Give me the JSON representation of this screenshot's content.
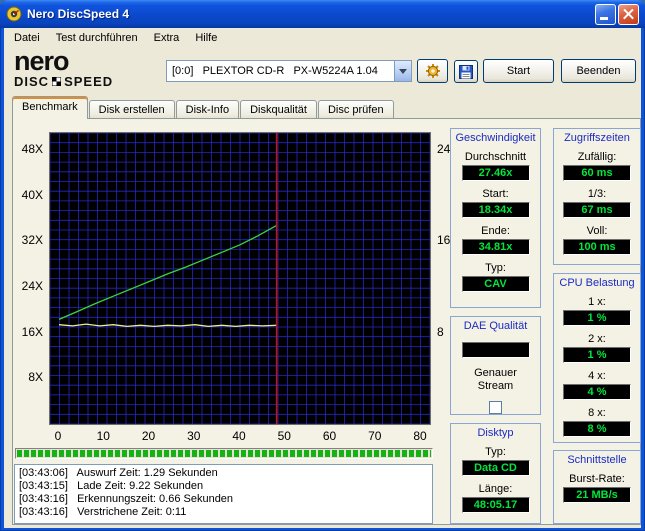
{
  "window": {
    "title": "Nero DiscSpeed 4"
  },
  "menu": {
    "items": [
      "Datei",
      "Test durchführen",
      "Extra",
      "Hilfe"
    ]
  },
  "toolbar": {
    "logo_brand": "nero",
    "logo_product_left": "DISC",
    "logo_product_right": "SPEED",
    "drive_selector": "[0:0]   PLEXTOR CD-R   PX-W5224A 1.04",
    "start_label": "Start",
    "quit_label": "Beenden"
  },
  "tabs": {
    "items": [
      "Benchmark",
      "Disk erstellen",
      "Disk-Info",
      "Diskqualität",
      "Disc prüfen"
    ],
    "active": "Benchmark"
  },
  "chart_data": {
    "type": "line",
    "xlim": [
      0,
      80
    ],
    "ylim_left": [
      0,
      51
    ],
    "ylim_right": [
      0,
      25.5
    ],
    "x_ticks": [
      0,
      10,
      20,
      30,
      40,
      50,
      60,
      70,
      80
    ],
    "y_tick_labels_left": [
      "48X",
      "40X",
      "32X",
      "24X",
      "16X",
      "8X"
    ],
    "y_tick_values_left": [
      48,
      40,
      32,
      24,
      16,
      8
    ],
    "y_tick_labels_right": [
      "24",
      "16",
      "8"
    ],
    "y_tick_values_right": [
      48,
      32,
      16
    ],
    "grid": true,
    "legend_position": "none",
    "series": [
      {
        "name": "read-speed-x",
        "color": "#3cd43c",
        "axis": "left",
        "points": [
          [
            0,
            18.34
          ],
          [
            4,
            19.7
          ],
          [
            8,
            21.1
          ],
          [
            12,
            22.4
          ],
          [
            16,
            23.7
          ],
          [
            20,
            25.0
          ],
          [
            24,
            26.3
          ],
          [
            28,
            27.5
          ],
          [
            32,
            28.8
          ],
          [
            36,
            30.1
          ],
          [
            40,
            31.4
          ],
          [
            44,
            33.0
          ],
          [
            48.09,
            34.81
          ]
        ]
      },
      {
        "name": "rotation-speed",
        "color": "#eded8a",
        "axis": "left",
        "points": [
          [
            0,
            17.4
          ],
          [
            3,
            17.2
          ],
          [
            6,
            17.5
          ],
          [
            9,
            17.2
          ],
          [
            12,
            17.4
          ],
          [
            15,
            17.1
          ],
          [
            18,
            17.3
          ],
          [
            21,
            17.1
          ],
          [
            24,
            17.3
          ],
          [
            27,
            17.2
          ],
          [
            30,
            17.4
          ],
          [
            33,
            17.1
          ],
          [
            36,
            17.3
          ],
          [
            39,
            17.1
          ],
          [
            42,
            17.3
          ],
          [
            45,
            17.2
          ],
          [
            48.09,
            17.3
          ]
        ]
      }
    ],
    "position_marker": {
      "x": 48.09,
      "color": "#c41414"
    }
  },
  "progress": {
    "value_percent": 100
  },
  "log": {
    "lines": [
      "[03:43:06]   Auswurf Zeit: 1.29 Sekunden",
      "[03:43:15]   Lade Zeit: 9.22 Sekunden",
      "[03:43:16]   Erkennungszeit: 0.66 Sekunden",
      "[03:43:16]   Verstrichene Zeit: 0:11"
    ]
  },
  "panels": {
    "speed": {
      "title": "Geschwindigkeit",
      "rows": [
        {
          "label": "Durchschnitt",
          "value": "27.46x"
        },
        {
          "label": "Start:",
          "value": "18.34x"
        },
        {
          "label": "Ende:",
          "value": "34.81x"
        },
        {
          "label": "Typ:",
          "value": "CAV"
        }
      ]
    },
    "access": {
      "title": "Zugriffszeiten",
      "rows": [
        {
          "label": "Zufällig:",
          "value": "60 ms"
        },
        {
          "label": "1/3:",
          "value": "67 ms"
        },
        {
          "label": "Voll:",
          "value": "100 ms"
        }
      ]
    },
    "cpu": {
      "title": "CPU Belastung",
      "rows": [
        {
          "label": "1 x:",
          "value": "1 %"
        },
        {
          "label": "2 x:",
          "value": "1 %"
        },
        {
          "label": "4 x:",
          "value": "4 %"
        },
        {
          "label": "8 x:",
          "value": "8 %"
        }
      ]
    },
    "dae": {
      "title": "DAE Qualität",
      "value": "",
      "stream_label": "Genauer\nStream",
      "checkbox_checked": false
    },
    "disc": {
      "title": "Disktyp",
      "rows": [
        {
          "label": "Typ:",
          "value": "Data CD"
        },
        {
          "label": "Länge:",
          "value": "48:05.17"
        }
      ]
    },
    "iface": {
      "title": "Schnittstelle",
      "rows": [
        {
          "label": "Burst-Rate:",
          "value": "21 MB/s"
        }
      ]
    }
  }
}
